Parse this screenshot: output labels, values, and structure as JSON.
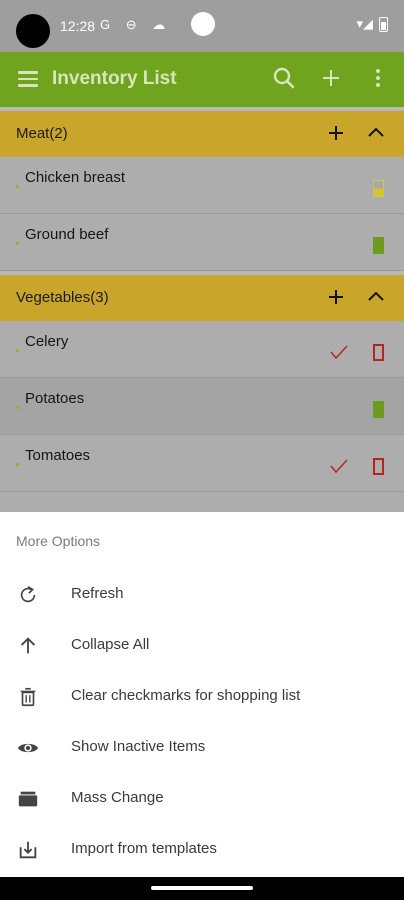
{
  "status_bar": {
    "time": "12:28",
    "left_icons": "G ⊖ ☁",
    "right_icons": "▾◢"
  },
  "app_bar": {
    "title": "Inventory List",
    "search_icon": "⌕",
    "add_icon": "+",
    "more_icon": "⋮"
  },
  "categories": [
    {
      "label": "Meat(2)",
      "items": [
        {
          "name": "Chicken breast"
        },
        {
          "name": "Ground beef"
        }
      ]
    },
    {
      "label": "Vegetables(3)",
      "items": [
        {
          "name": "Celery"
        },
        {
          "name": "Potatoes"
        },
        {
          "name": "Tomatoes"
        }
      ]
    }
  ],
  "sheet": {
    "title": "More Options",
    "options": [
      {
        "label": "Refresh",
        "icon": "refresh-icon"
      },
      {
        "label": "Collapse All",
        "icon": "arrow-up-icon"
      },
      {
        "label": "Clear checkmarks for shopping list",
        "icon": "trash-icon"
      },
      {
        "label": "Show Inactive Items",
        "icon": "eye-icon"
      },
      {
        "label": "Mass Change",
        "icon": "folder-icon"
      },
      {
        "label": "Import from templates",
        "icon": "download-icon"
      }
    ]
  },
  "colors": {
    "app_bar": "#70a31e",
    "category_header": "#c9a52a",
    "alert_red": "#b3261e",
    "ok_green": "#6e9a22",
    "warn_yellow": "#d6c330"
  }
}
